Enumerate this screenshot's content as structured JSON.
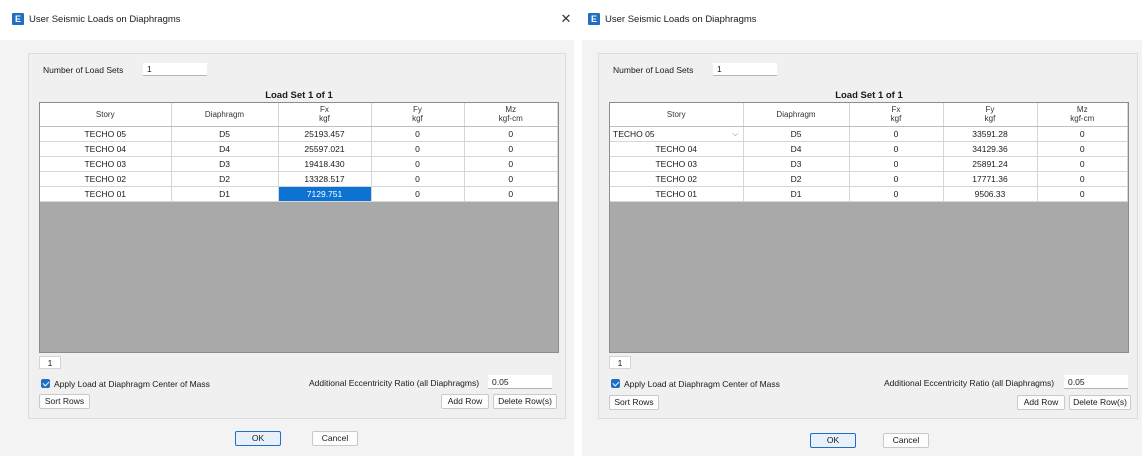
{
  "dialogs": [
    {
      "title": "User Seismic Loads on Diaphragms",
      "app_icon_letter": "E",
      "close_glyph": "✕",
      "number_of_load_sets_label": "Number of Load Sets",
      "number_of_load_sets_value": "1",
      "load_set_title": "Load Set 1 of 1",
      "columns": [
        {
          "name": "Story",
          "unit": ""
        },
        {
          "name": "Diaphragm",
          "unit": ""
        },
        {
          "name": "Fx",
          "unit": "kgf"
        },
        {
          "name": "Fy",
          "unit": "kgf"
        },
        {
          "name": "Mz",
          "unit": "kgf-cm"
        }
      ],
      "rows": [
        [
          "TECHO 05",
          "D5",
          "25193.457",
          "0",
          "0"
        ],
        [
          "TECHO 04",
          "D4",
          "25597.021",
          "0",
          "0"
        ],
        [
          "TECHO 03",
          "D3",
          "19418.430",
          "0",
          "0"
        ],
        [
          "TECHO 02",
          "D2",
          "13328.517",
          "0",
          "0"
        ],
        [
          "TECHO 01",
          "D1",
          "7129.751",
          "0",
          "0"
        ]
      ],
      "page_tab": "1",
      "apply_load_label": "Apply Load at Diaphragm Center of Mass",
      "eccentricity_label": "Additional Eccentricity Ratio (all Diaphragms)",
      "eccentricity_value": "0.05",
      "sort_rows_label": "Sort Rows",
      "add_row_label": "Add Row",
      "delete_rows_label": "Delete Row(s)",
      "ok_label": "OK",
      "cancel_label": "Cancel"
    },
    {
      "title": "User Seismic Loads on Diaphragms",
      "app_icon_letter": "E",
      "number_of_load_sets_label": "Number of Load Sets",
      "number_of_load_sets_value": "1",
      "load_set_title": "Load Set 1 of 1",
      "columns": [
        {
          "name": "Story",
          "unit": ""
        },
        {
          "name": "Diaphragm",
          "unit": ""
        },
        {
          "name": "Fx",
          "unit": "kgf"
        },
        {
          "name": "Fy",
          "unit": "kgf"
        },
        {
          "name": "Mz",
          "unit": "kgf-cm"
        }
      ],
      "rows": [
        [
          "TECHO 05",
          "D5",
          "0",
          "33591.28",
          "0"
        ],
        [
          "TECHO 04",
          "D4",
          "0",
          "34129.36",
          "0"
        ],
        [
          "TECHO 03",
          "D3",
          "0",
          "25891.24",
          "0"
        ],
        [
          "TECHO 02",
          "D2",
          "0",
          "17771.36",
          "0"
        ],
        [
          "TECHO 01",
          "D1",
          "0",
          "9506.33",
          "0"
        ]
      ],
      "combo_arrow_glyph": "⌵",
      "page_tab": "1",
      "apply_load_label": "Apply Load at Diaphragm Center of Mass",
      "eccentricity_label": "Additional Eccentricity Ratio (all Diaphragms)",
      "eccentricity_value": "0.05",
      "sort_rows_label": "Sort Rows",
      "add_row_label": "Add Row",
      "delete_rows_label": "Delete Row(s)",
      "ok_label": "OK",
      "cancel_label": "Cancel"
    }
  ],
  "colors": {
    "accent": "#1f6fc5",
    "selected_cell": "#0d73d3",
    "grid_empty": "#a9a9a9",
    "dialog_bg": "#f3f3f3"
  }
}
